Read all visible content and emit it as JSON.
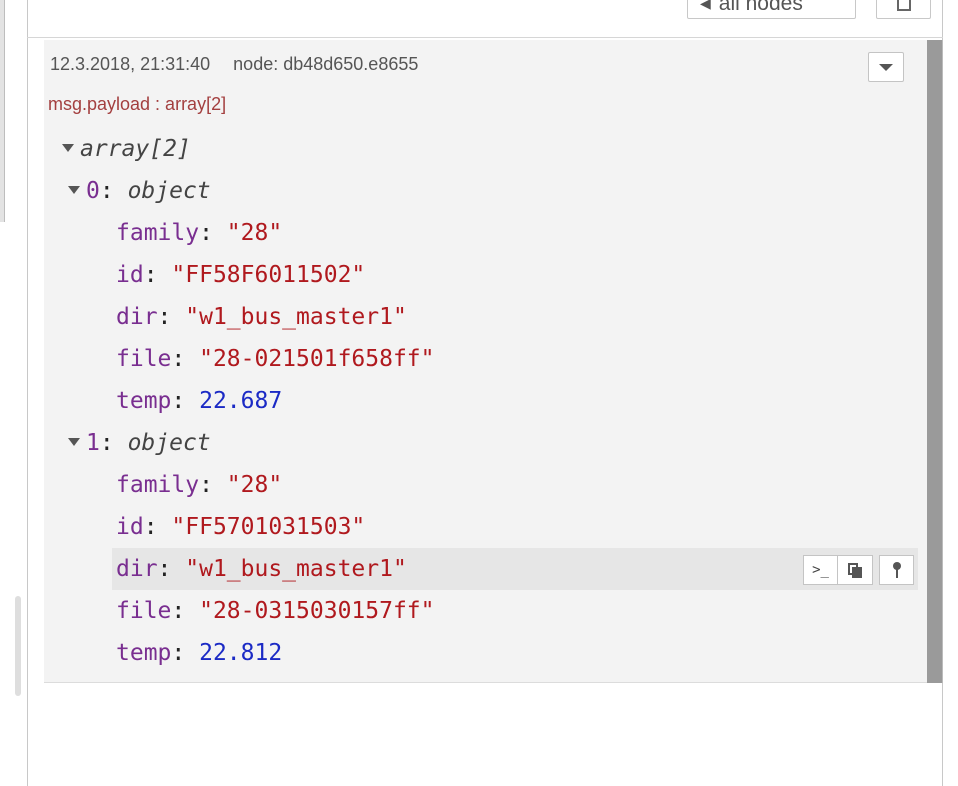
{
  "toolbar": {
    "filter_label": "all nodes",
    "clear_icon": "trash-icon"
  },
  "message": {
    "timestamp": "12.3.2018, 21:31:40",
    "node": "node: db48d650.e8655",
    "topic": "msg.payload : array[2]",
    "root_label": "array[2]",
    "items": [
      {
        "index": "0",
        "type": "object",
        "props": [
          {
            "key": "family",
            "value": "\"28\"",
            "kind": "str"
          },
          {
            "key": "id",
            "value": "\"FF58F6011502\"",
            "kind": "str"
          },
          {
            "key": "dir",
            "value": "\"w1_bus_master1\"",
            "kind": "str"
          },
          {
            "key": "file",
            "value": "\"28-021501f658ff\"",
            "kind": "str"
          },
          {
            "key": "temp",
            "value": "22.687",
            "kind": "num"
          }
        ]
      },
      {
        "index": "1",
        "type": "object",
        "props": [
          {
            "key": "family",
            "value": "\"28\"",
            "kind": "str"
          },
          {
            "key": "id",
            "value": "\"FF5701031503\"",
            "kind": "str"
          },
          {
            "key": "dir",
            "value": "\"w1_bus_master1\"",
            "kind": "str"
          },
          {
            "key": "file",
            "value": "\"28-0315030157ff\"",
            "kind": "str"
          },
          {
            "key": "temp",
            "value": "22.812",
            "kind": "num"
          }
        ]
      }
    ]
  },
  "colors": {
    "key": "#792e90",
    "string": "#b0191e",
    "number": "#1b2ac5",
    "topic": "#a33f3f"
  }
}
